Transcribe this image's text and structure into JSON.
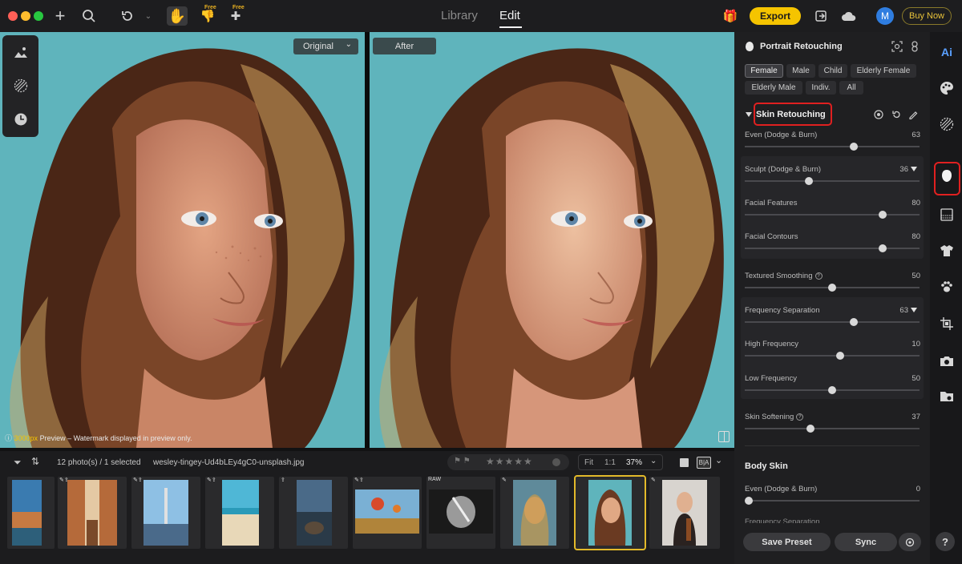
{
  "topbar": {
    "nav_library": "Library",
    "nav_edit": "Edit",
    "free_badge_1": "Free",
    "free_badge_2": "Free",
    "export_label": "Export",
    "avatar_initial": "M",
    "buy_now_label": "Buy Now"
  },
  "preview": {
    "original_label": "Original",
    "after_label": "After",
    "watermark_highlight": "3000px",
    "watermark_text": " Preview – Watermark displayed in preview only."
  },
  "filmstrip": {
    "count_text": "12 photo(s) / 1 selected",
    "filename": "wesley-tingey-Ud4bLEy4gC0-unsplash.jpg",
    "zoom_fit": "Fit",
    "zoom_one": "1:1",
    "zoom_pct": "37%",
    "ba_label": "B|A",
    "raw_tag": "RAW",
    "stars": "★★★★★"
  },
  "panel": {
    "title": "Portrait Retouching",
    "chips": [
      "Female",
      "Male",
      "Child",
      "Elderly Female",
      "Elderly Male",
      "Indiv.",
      "All"
    ],
    "active_chip": "Female",
    "section_title": "Skin Retouching",
    "sliders": {
      "even": {
        "label": "Even (Dodge & Burn)",
        "value": 63
      },
      "sculpt": {
        "label": "Sculpt (Dodge & Burn)",
        "value": 36
      },
      "facial_features": {
        "label": "Facial Features",
        "value": 80
      },
      "facial_contours": {
        "label": "Facial Contours",
        "value": 80
      },
      "textured_smoothing": {
        "label": "Textured Smoothing",
        "value": 50
      },
      "frequency_separation": {
        "label": "Frequency Separation",
        "value": 63
      },
      "high_frequency": {
        "label": "High Frequency",
        "value": 10
      },
      "low_frequency": {
        "label": "Low Frequency",
        "value": 50
      },
      "skin_softening": {
        "label": "Skin Softening",
        "value": 37
      },
      "body_even": {
        "label": "Even (Dodge & Burn)",
        "value": 0
      }
    },
    "body_skin_title": "Body Skin",
    "cut_label": "Frequency Separation",
    "save_preset_label": "Save Preset",
    "sync_label": "Sync"
  },
  "rail": {
    "ai_label": "Ai",
    "help_label": "?"
  },
  "colors": {
    "accent_yellow": "#f5c400",
    "highlight_red": "#e02020",
    "backdrop_teal": "#5fb4bc"
  }
}
